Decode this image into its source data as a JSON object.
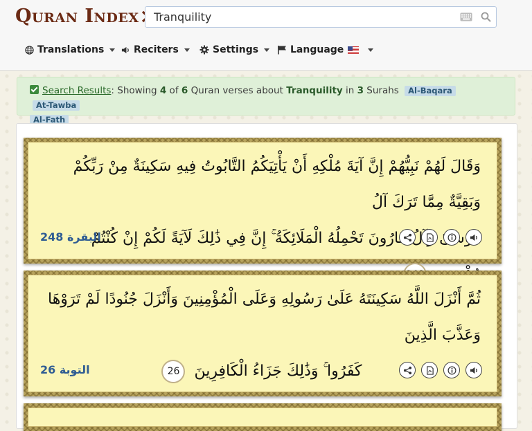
{
  "header": {
    "logo_text": "Quran Index",
    "search": {
      "value": "Tranquility",
      "placeholder": ""
    },
    "nav": {
      "translations": "Translations",
      "reciters": "Reciters",
      "settings": "Settings",
      "language": "Language"
    }
  },
  "alert": {
    "link": "Search Results",
    "text_1": ": Showing ",
    "shown": "4",
    "text_2": " of ",
    "total": "6",
    "text_3": " Quran verses about ",
    "query": "Tranquility",
    "text_4": " in ",
    "surah_count": "3",
    "text_5": " Surahs",
    "tags": [
      "Al-Baqara",
      "At-Tawba",
      "Al-Fath"
    ]
  },
  "verses": [
    {
      "line1": "وَقَالَ لَهُمْ نَبِيُّهُمْ إِنَّ آيَةَ مُلْكِهِ أَنْ يَأْتِيَكُمُ التَّابُوتُ فِيهِ سَكِينَةٌ مِنْ رَبِّكُمْ وَبَقِيَّةٌ مِمَّا تَرَكَ آلُ",
      "line2": "مُوسَىٰ وَآلُ هَارُونَ تَحْمِلُهُ الْمَلَائِكَةُ ۚ إِنَّ فِي ذَٰلِكَ لَآيَةً لَكُمْ إِنْ كُنْتُمْ مُؤْمِنِينَ",
      "number": "248",
      "ref": "البقرة 248"
    },
    {
      "line1": "ثُمَّ أَنْزَلَ اللَّهُ سَكِينَتَهُ عَلَىٰ رَسُولِهِ وَعَلَى الْمُؤْمِنِينَ وَأَنْزَلَ جُنُودًا لَمْ تَرَوْهَا وَعَذَّبَ الَّذِينَ",
      "line2": "كَفَرُوا ۚ وَذَٰلِكَ جَزَاءُ الْكَافِرِينَ",
      "number": "26",
      "ref": "التوبة 26"
    }
  ],
  "colors": {
    "accent_blue": "#2f5c93",
    "logo_brown": "#6b2a14",
    "verse_bg": "#fbf6b8",
    "alert_bg": "#dff0d8"
  },
  "icons": [
    "globe-icon",
    "speaker-icon",
    "gear-icon",
    "flag-icon",
    "share-icon",
    "pdf-icon",
    "info-icon",
    "audio-icon"
  ]
}
